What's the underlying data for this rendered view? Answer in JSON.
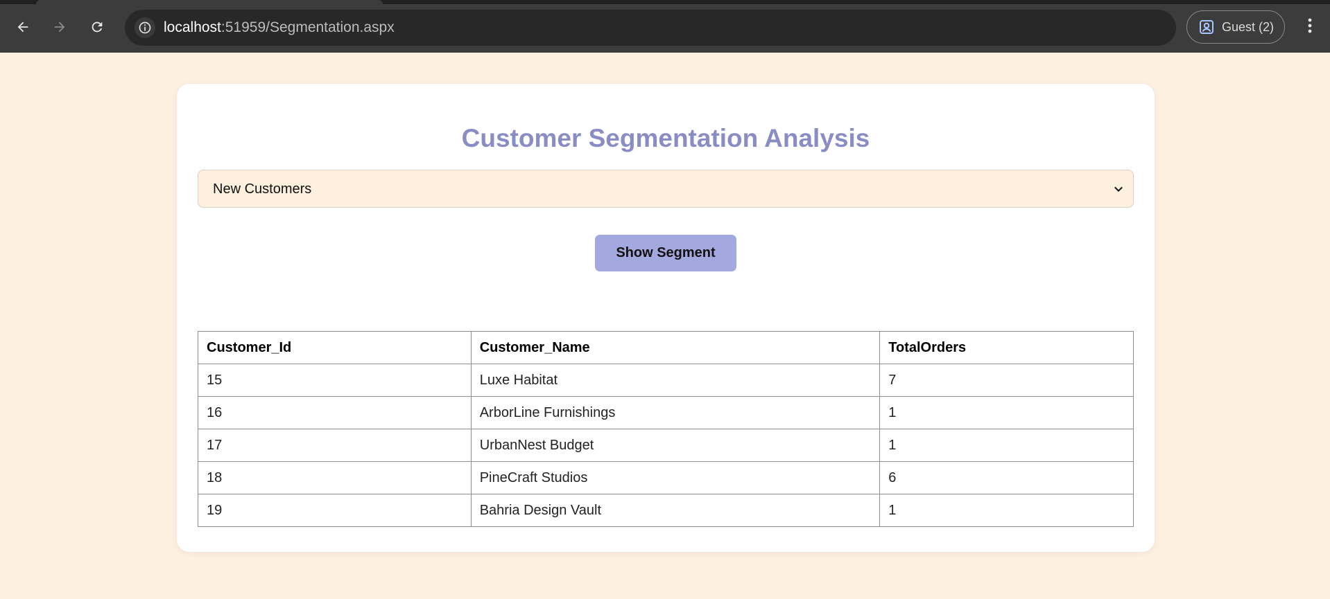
{
  "browser": {
    "url_host": "localhost",
    "url_rest": ":51959/Segmentation.aspx",
    "profile_label": "Guest (2)",
    "icons": {
      "back": "arrow-left-icon",
      "forward": "arrow-right-icon",
      "reload": "reload-icon",
      "site_info": "info-icon",
      "profile": "profile-icon",
      "menu": "kebab-menu-icon"
    }
  },
  "page": {
    "title": "Customer Segmentation Analysis",
    "segment_select": {
      "selected": "New Customers"
    },
    "show_button_label": "Show Segment",
    "table": {
      "headers": [
        "Customer_Id",
        "Customer_Name",
        "TotalOrders"
      ],
      "rows": [
        [
          "15",
          "Luxe Habitat",
          "7"
        ],
        [
          "16",
          "ArborLine Furnishings",
          "1"
        ],
        [
          "17",
          "UrbanNest Budget",
          "1"
        ],
        [
          "18",
          "PineCraft Studios",
          "6"
        ],
        [
          "19",
          "Bahria Design Vault",
          "1"
        ]
      ]
    }
  },
  "colors": {
    "page_bg": "#fef0e0",
    "title": "#8a8cc4",
    "button_bg": "#a3a8df",
    "select_bg": "#fef0dd",
    "chrome_bg": "#3c3c3c"
  }
}
